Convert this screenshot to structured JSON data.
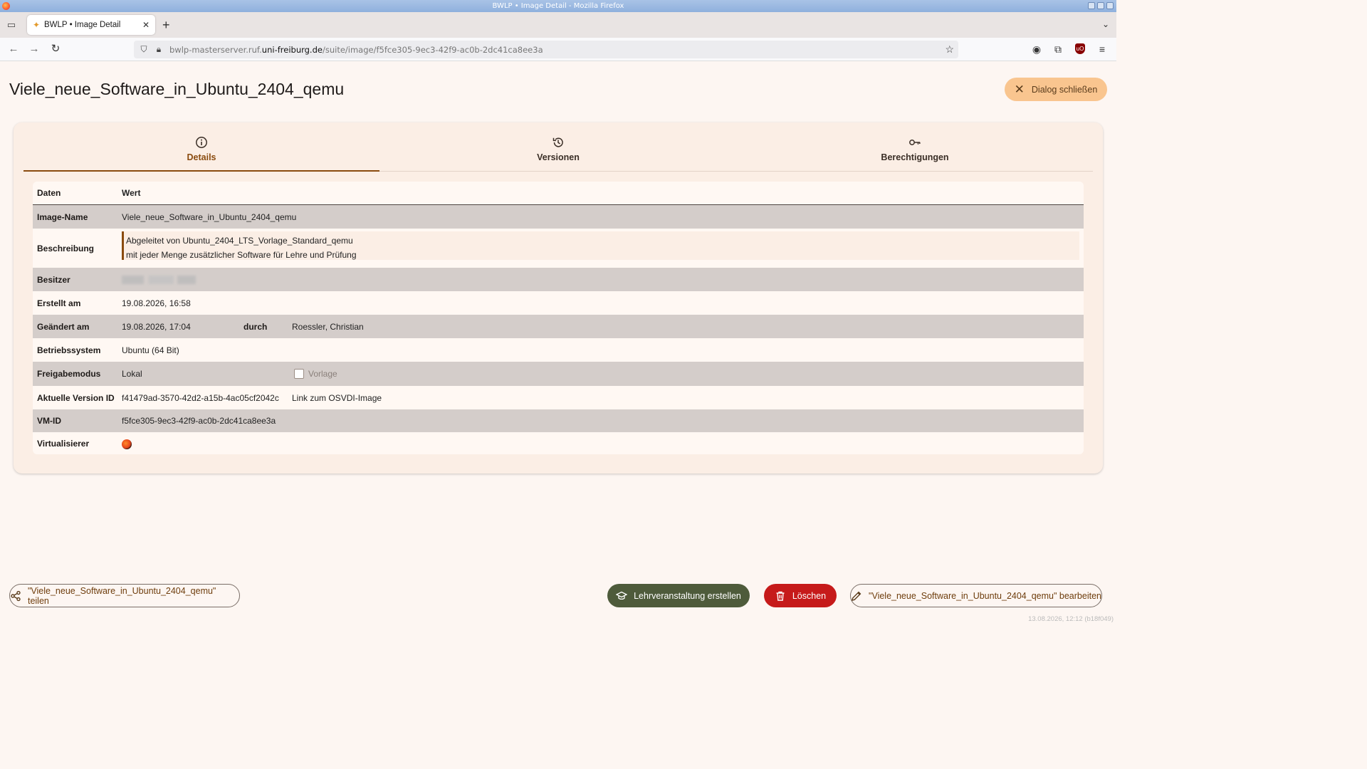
{
  "window": {
    "title": "BWLP • Image Detail - Mozilla Firefox"
  },
  "browser": {
    "tab_label": "BWLP • Image Detail",
    "url_prefix": "bwlp-masterserver.ruf.",
    "url_domain": "uni-freiburg.de",
    "url_path": "/suite/image/f5fce305-9ec3-42f9-ac0b-2dc41ca8ee3a"
  },
  "page": {
    "title": "Viele_neue_Software_in_Ubuntu_2404_qemu",
    "close_label": "Dialog schließen"
  },
  "tabs": [
    {
      "label": "Details",
      "icon": "info-icon",
      "active": true
    },
    {
      "label": "Versionen",
      "icon": "history-icon",
      "active": false
    },
    {
      "label": "Berechtigungen",
      "icon": "key-icon",
      "active": false
    }
  ],
  "table": {
    "header": {
      "key": "Daten",
      "value": "Wert"
    },
    "image_name": {
      "key": "Image-Name",
      "value": "Viele_neue_Software_in_Ubuntu_2404_qemu"
    },
    "description": {
      "key": "Beschreibung",
      "line1": "Abgeleitet von Ubuntu_2404_LTS_Vorlage_Standard_qemu",
      "line2": "mit jeder Menge zusätzlicher Software für Lehre und Prüfung"
    },
    "owner": {
      "key": "Besitzer"
    },
    "created": {
      "key": "Erstellt am",
      "value": "19.08.2026, 16:58"
    },
    "changed": {
      "key": "Geändert am",
      "value": "19.08.2026, 17:04",
      "by_label": "durch",
      "by_value": "Roessler, Christian"
    },
    "os": {
      "key": "Betriebssystem",
      "value": "Ubuntu (64 Bit)"
    },
    "share_mode": {
      "key": "Freigabemodus",
      "value": "Lokal",
      "template_label": "Vorlage",
      "template_checked": false
    },
    "version": {
      "key": "Aktuelle Version ID",
      "value": "f41479ad-3570-42d2-a15b-4ac05cf2042c",
      "link_label": "Link zum OSVDI-Image"
    },
    "vm_id": {
      "key": "VM-ID",
      "value": "f5fce305-9ec3-42f9-ac0b-2dc41ca8ee3a"
    },
    "virtualizer": {
      "key": "Virtualisierer",
      "icon": "qemu-icon"
    }
  },
  "footer": {
    "share_label": "\"Viele_neue_Software_in_Ubuntu_2404_qemu\" teilen",
    "course_label": "Lehrveranstaltung erstellen",
    "delete_label": "Löschen",
    "edit_label": "\"Viele_neue_Software_in_Ubuntu_2404_qemu\" bearbeiten",
    "stamp": "13.08.2026, 12:12 (b18f049)"
  },
  "colors": {
    "accent": "#8a4b0f",
    "close_button": "#f9c58f",
    "course_button": "#4e5b3b",
    "delete_button": "#c61a1a"
  }
}
